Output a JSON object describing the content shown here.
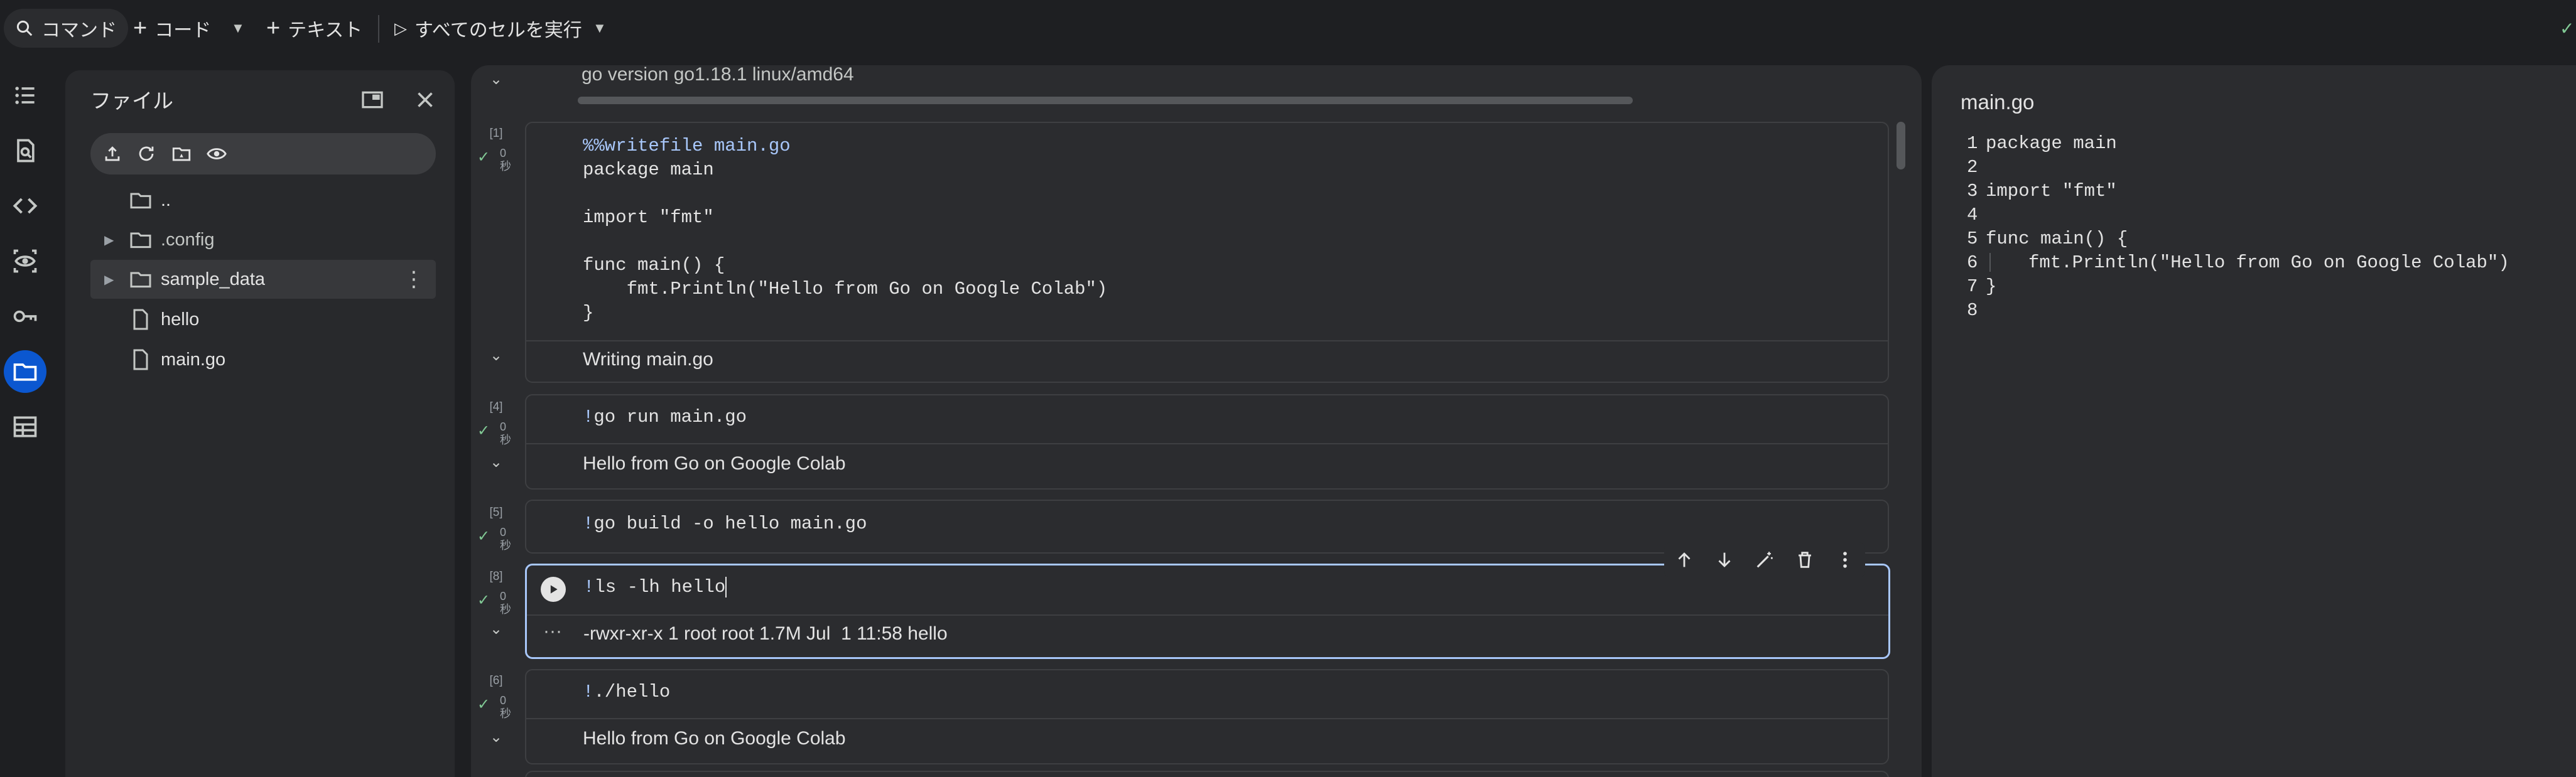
{
  "toolbar": {
    "command_label": "コマンド",
    "code_label": "コード",
    "text_label": "テキスト",
    "run_all_label": "すべてのセルを実行"
  },
  "rail": {
    "icons": [
      "list-icon",
      "search-code-icon",
      "code-icon",
      "variables-eye-icon",
      "key-icon",
      "folder-icon",
      "table-icon"
    ],
    "active": "folder-icon"
  },
  "files": {
    "title": "ファイル",
    "items": [
      {
        "name": "..",
        "type": "folder",
        "expandable": false
      },
      {
        "name": ".config",
        "type": "folder",
        "expandable": true
      },
      {
        "name": "sample_data",
        "type": "folder",
        "expandable": true,
        "selected": true
      },
      {
        "name": "hello",
        "type": "file",
        "expandable": false
      },
      {
        "name": "main.go",
        "type": "file",
        "expandable": false
      }
    ]
  },
  "notebook": {
    "prev_output": "go version go1.18.1 linux/amd64",
    "cells": [
      {
        "count": "[1]",
        "time_num": "0",
        "time_unit": "秒",
        "code_magic": "%%writefile main.go",
        "code_lines": [
          "package main",
          "",
          "import \"fmt\"",
          "",
          "func main() {",
          "    fmt.Println(\"Hello from Go on Google Colab\")",
          "}"
        ],
        "output": "Writing main.go"
      },
      {
        "count": "[4]",
        "time_num": "0",
        "time_unit": "秒",
        "code_bang": "!",
        "code_rest": "go run main.go",
        "output": "Hello from Go on Google Colab"
      },
      {
        "count": "[5]",
        "time_num": "0",
        "time_unit": "秒",
        "code_bang": "!",
        "code_rest": "go build -o hello main.go"
      },
      {
        "count": "[8]",
        "time_num": "0",
        "time_unit": "秒",
        "code_bang": "!",
        "code_rest": "ls -lh hello",
        "output": "-rwxr-xr-x 1 root root 1.7M Jul  1 11:58 hello"
      },
      {
        "count": "[6]",
        "time_num": "0",
        "time_unit": "秒",
        "code_bang": "!",
        "code_rest": "./hello",
        "output": "Hello from Go on Google Colab"
      }
    ]
  },
  "editor": {
    "title": "main.go",
    "lines": [
      {
        "n": "1",
        "text": "package main"
      },
      {
        "n": "2",
        "text": ""
      },
      {
        "n": "3",
        "text": "import \"fmt\""
      },
      {
        "n": "4",
        "text": ""
      },
      {
        "n": "5",
        "text": "func main() {"
      },
      {
        "n": "6",
        "text": "fmt.Println(\"Hello from Go on Google Colab\")"
      },
      {
        "n": "7",
        "text": "}"
      },
      {
        "n": "8",
        "text": ""
      }
    ]
  },
  "colors": {
    "accent": "#0b57d0",
    "active_border": "#a8c7fa",
    "success": "#81c995"
  }
}
